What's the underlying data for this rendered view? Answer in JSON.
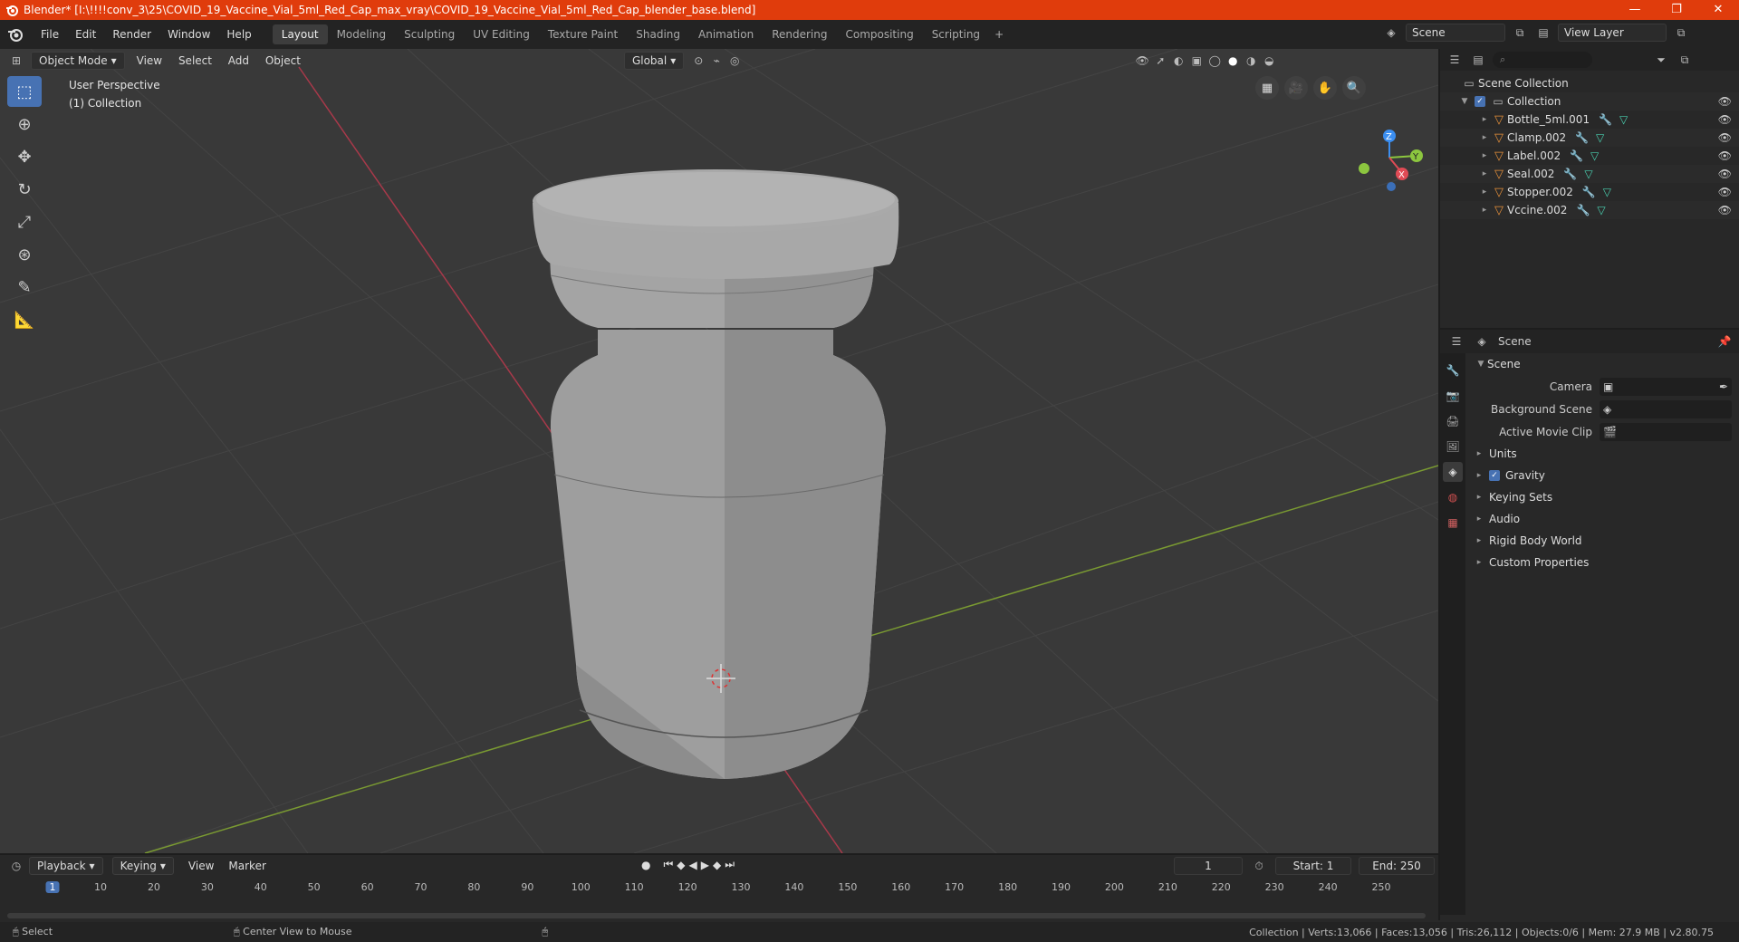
{
  "window": {
    "title": "Blender* [I:\\!!!!conv_3\\25\\COVID_19_Vaccine_Vial_5ml_Red_Cap_max_vray\\COVID_19_Vaccine_Vial_5ml_Red_Cap_blender_base.blend]",
    "controls": [
      "—",
      "❐",
      "✕"
    ]
  },
  "menubar": {
    "items": [
      "File",
      "Edit",
      "Render",
      "Window",
      "Help"
    ]
  },
  "workspace_tabs": {
    "items": [
      "Layout",
      "Modeling",
      "Sculpting",
      "UV Editing",
      "Texture Paint",
      "Shading",
      "Animation",
      "Rendering",
      "Compositing",
      "Scripting"
    ],
    "active": "Layout",
    "add": "+"
  },
  "top_right": {
    "scene": "Scene",
    "view_layer": "View Layer"
  },
  "viewport": {
    "mode": "Object Mode",
    "menu": [
      "View",
      "Select",
      "Add",
      "Object"
    ],
    "transform": "Global",
    "info_line1": "User Perspective",
    "info_line2": "(1) Collection",
    "axis_x": "X",
    "axis_y": "Y",
    "axis_z": "Z"
  },
  "outliner": {
    "search_placeholder": "",
    "root": "Scene Collection",
    "collection": "Collection",
    "objects": [
      "Bottle_5ml.001",
      "Clamp.002",
      "Label.002",
      "Seal.002",
      "Stopper.002",
      "Vccine.002"
    ]
  },
  "properties": {
    "context": "Scene",
    "panel": "Scene",
    "camera_label": "Camera",
    "bg_scene_label": "Background Scene",
    "movie_clip_label": "Active Movie Clip",
    "subpanels": [
      "Units",
      "Gravity",
      "Keying Sets",
      "Audio",
      "Rigid Body World",
      "Custom Properties"
    ]
  },
  "timeline": {
    "menu": [
      "Playback",
      "Keying",
      "View",
      "Marker"
    ],
    "current_frame": "1",
    "start_label": "Start:",
    "start": "1",
    "end_label": "End:",
    "end": "250",
    "ticks": [
      "1",
      "10",
      "20",
      "30",
      "40",
      "50",
      "60",
      "70",
      "80",
      "90",
      "100",
      "110",
      "120",
      "130",
      "140",
      "150",
      "160",
      "170",
      "180",
      "190",
      "200",
      "210",
      "220",
      "230",
      "240",
      "250"
    ]
  },
  "statusbar": {
    "select": "Select",
    "center_view": "Center View to Mouse",
    "stats": "Collection | Verts:13,066 | Faces:13,056 | Tris:26,112 | Objects:0/6 | Mem: 27.9 MB | v2.80.75"
  },
  "colors": {
    "title_bar": "#e03c0c",
    "accent": "#4772b3",
    "object_icon": "#e8913a",
    "x_axis": "#e04b55",
    "y_axis": "#8cc63f",
    "z_axis": "#3b8ef0"
  }
}
